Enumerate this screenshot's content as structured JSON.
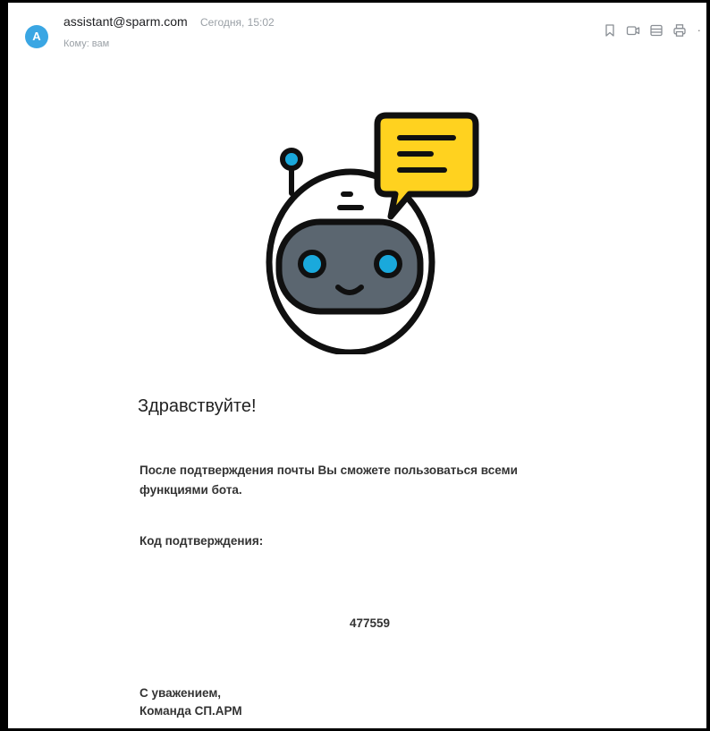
{
  "header": {
    "avatar_letter": "A",
    "sender": "assistant@sparm.com",
    "date": "Сегодня, 15:02",
    "recipient_label": "Кому:",
    "recipient": "вам",
    "more": "·",
    "actions": [
      "bookmark-icon",
      "video-icon",
      "calendar-icon",
      "print-icon"
    ]
  },
  "colors": {
    "avatar": "#3aa6e3",
    "bubble": "#ffd21f",
    "bot_body": "#ffffff",
    "bot_face": "#5b6670",
    "eye": "#1aa9dc",
    "outline": "#101010"
  },
  "body": {
    "greeting": "Здравствуйте!",
    "paragraph_line1": "После подтверждения почты Вы сможете пользоваться всеми",
    "paragraph_line2": "функциями бота.",
    "code_label": "Код подтверждения:",
    "code": "477559",
    "signoff_line1": "С уважением,",
    "signoff_line2": "Команда СП.АРМ"
  }
}
